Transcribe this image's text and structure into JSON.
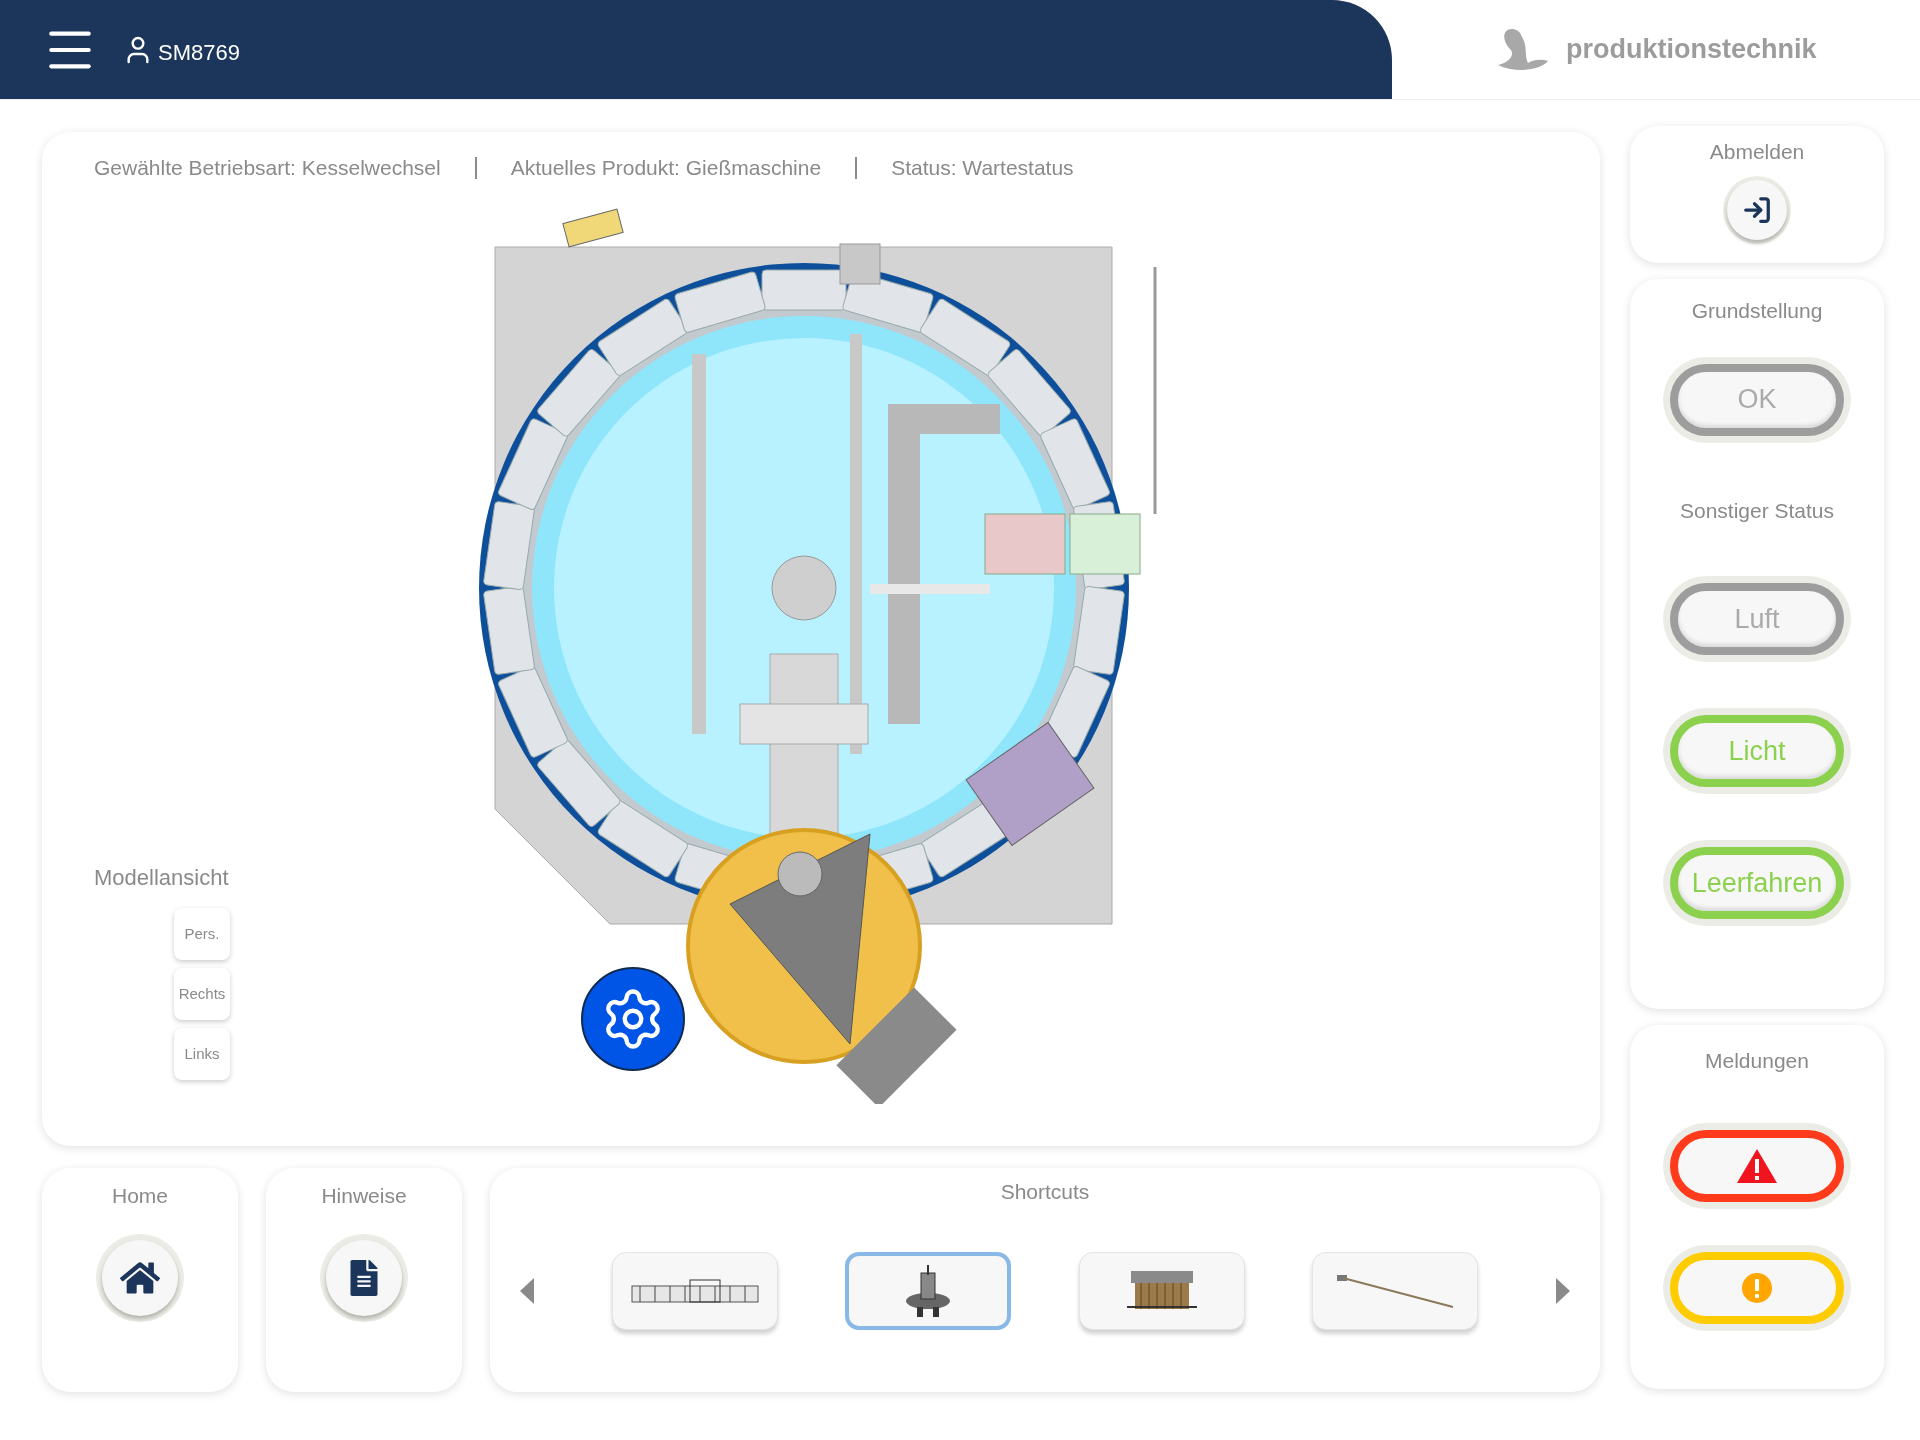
{
  "header": {
    "user": "SM8769",
    "brand": "produktionstechnik"
  },
  "status_line": [
    "Gewählte Betriebsart: Kesselwechsel",
    "Aktuelles Produkt: Gießmaschine",
    "Status: Wartestatus"
  ],
  "model_view": {
    "title": "Modellansicht",
    "buttons": [
      "Pers.",
      "Rechts",
      "Links"
    ]
  },
  "bottom": {
    "home": {
      "title": "Home"
    },
    "hints": {
      "title": "Hinweise"
    },
    "shortcuts": {
      "title": "Shortcuts",
      "items": [
        {
          "kind": "line",
          "selected": false
        },
        {
          "kind": "carousel",
          "selected": true
        },
        {
          "kind": "rack",
          "selected": false
        },
        {
          "kind": "rod",
          "selected": false
        }
      ]
    }
  },
  "logout": {
    "title": "Abmelden"
  },
  "home_position": {
    "title": "Grundstellung",
    "button": {
      "label": "OK",
      "active": false
    }
  },
  "other_status": {
    "title": "Sonstiger Status",
    "buttons": [
      {
        "label": "Luft",
        "active": false
      },
      {
        "label": "Licht",
        "active": true
      },
      {
        "label": "Leerfahren",
        "active": true
      }
    ]
  },
  "messages": {
    "title": "Meldungen",
    "indicators": [
      {
        "kind": "error"
      },
      {
        "kind": "warning"
      }
    ]
  }
}
